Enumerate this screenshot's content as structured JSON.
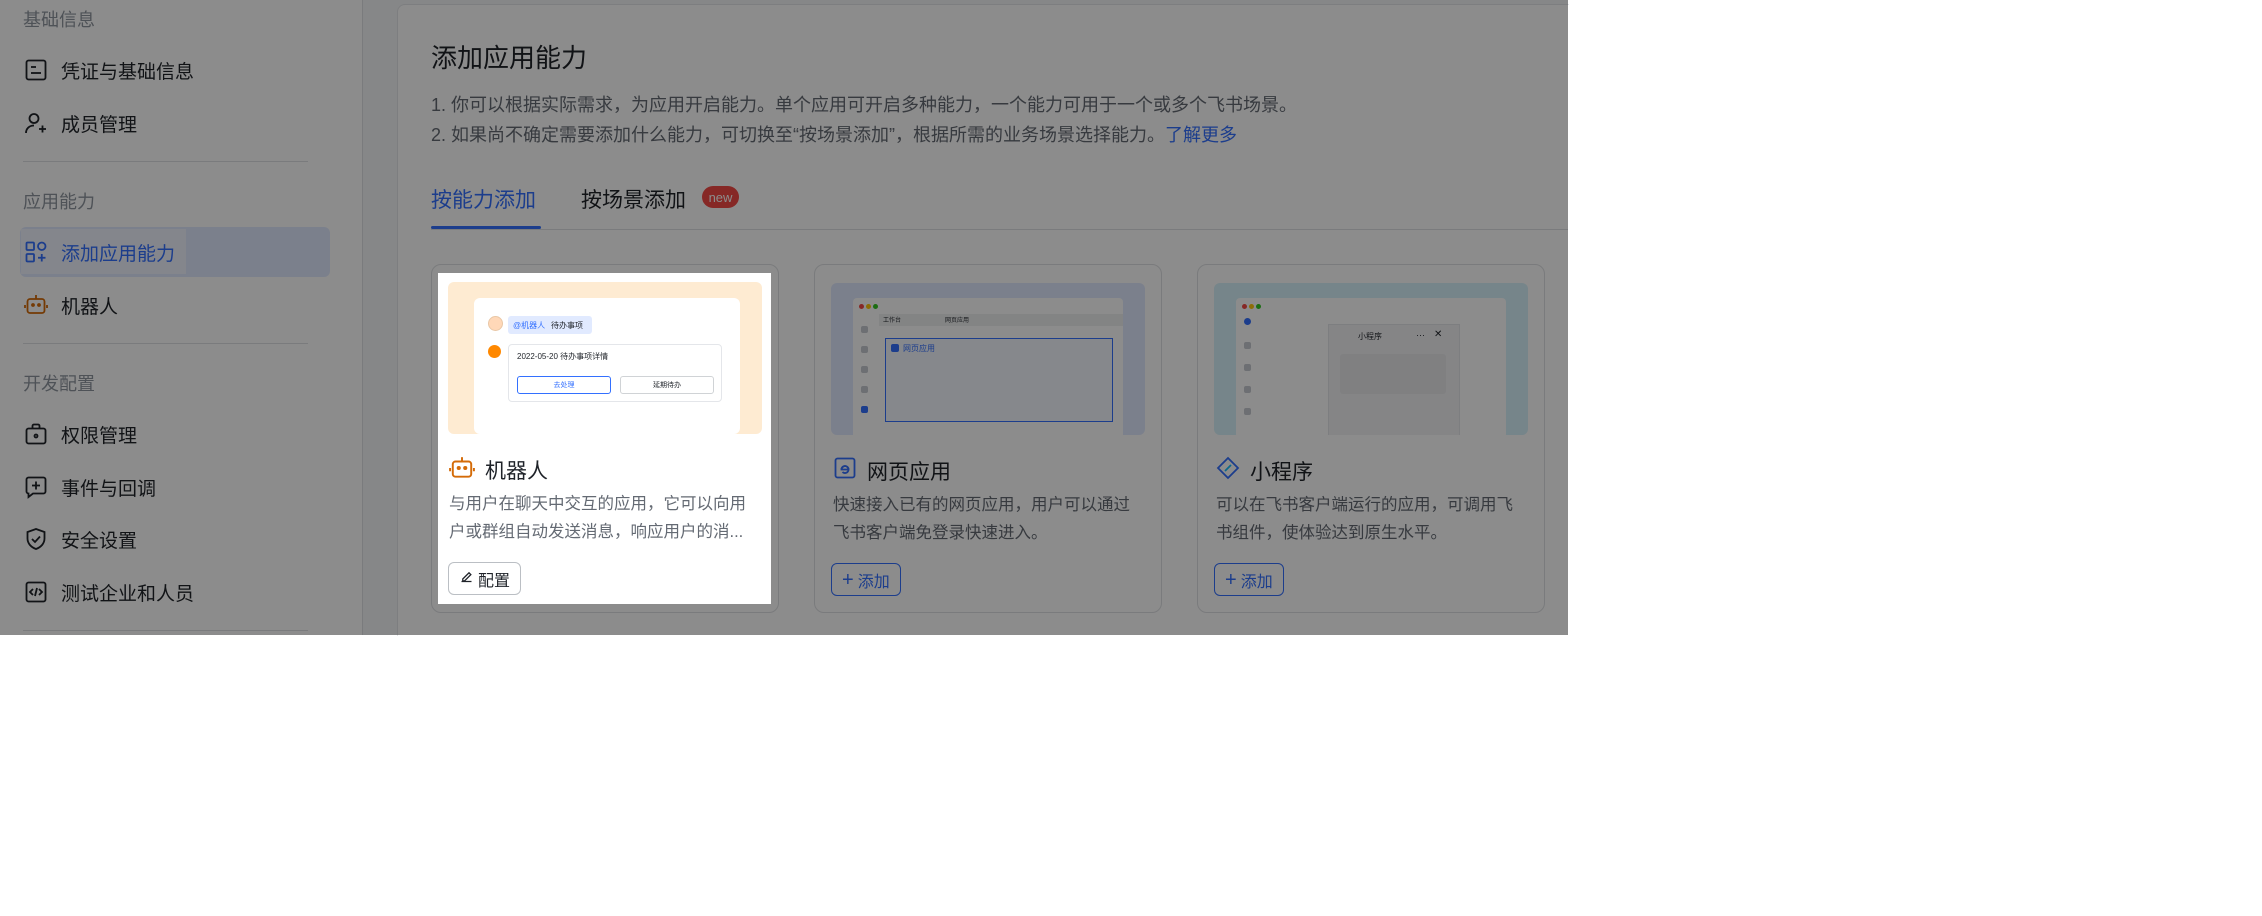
{
  "sidebar": {
    "section_basic": "基础信息",
    "section_capability": "应用能力",
    "section_dev": "开发配置",
    "items": [
      {
        "label": "凭证与基础信息",
        "icon": "credential-icon"
      },
      {
        "label": "成员管理",
        "icon": "member-icon"
      },
      {
        "label": "添加应用能力",
        "icon": "add-capability-icon",
        "active": true
      },
      {
        "label": "机器人",
        "icon": "robot-icon"
      },
      {
        "label": "权限管理",
        "icon": "permission-icon"
      },
      {
        "label": "事件与回调",
        "icon": "event-icon"
      },
      {
        "label": "安全设置",
        "icon": "shield-icon"
      },
      {
        "label": "测试企业和人员",
        "icon": "test-icon"
      }
    ]
  },
  "main": {
    "title": "添加应用能力",
    "desc_line1": "1. 你可以根据实际需求，为应用开启能力。单个应用可开启多种能力，一个能力可用于一个或多个飞书场景。",
    "desc_line2": "2. 如果尚不确定需要添加什么能力，可切换至“按场景添加”，根据所需的业务场景选择能力。",
    "learn_more": "了解更多",
    "tabs": [
      {
        "label": "按能力添加",
        "active": true
      },
      {
        "label": "按场景添加",
        "badge": "new"
      }
    ]
  },
  "cards": [
    {
      "title": "机器人",
      "desc": "与用户在聊天中交互的应用，它可以向用户或群组自动发送消息，响应用户的消...",
      "button": "配置",
      "preview": {
        "mention": "@机器人",
        "mention_text": "待办事项",
        "item": "2022-05-20 待办事项详情",
        "btn_primary": "去处理",
        "btn_secondary": "延期待办"
      }
    },
    {
      "title": "网页应用",
      "desc": "快速接入已有的网页应用，用户可以通过飞书客户端免登录快速进入。",
      "button": "添加",
      "preview": {
        "tab1": "工作台",
        "tab2": "网页应用",
        "panel_label": "网页应用"
      }
    },
    {
      "title": "小程序",
      "desc": "可以在飞书客户端运行的应用，可调用飞书组件，使体验达到原生水平。",
      "button": "添加",
      "preview": {
        "window_title": "小程序"
      }
    }
  ],
  "colors": {
    "accent": "#3370ff",
    "badge": "#f54a45",
    "robot_orange": "#d46b08"
  }
}
